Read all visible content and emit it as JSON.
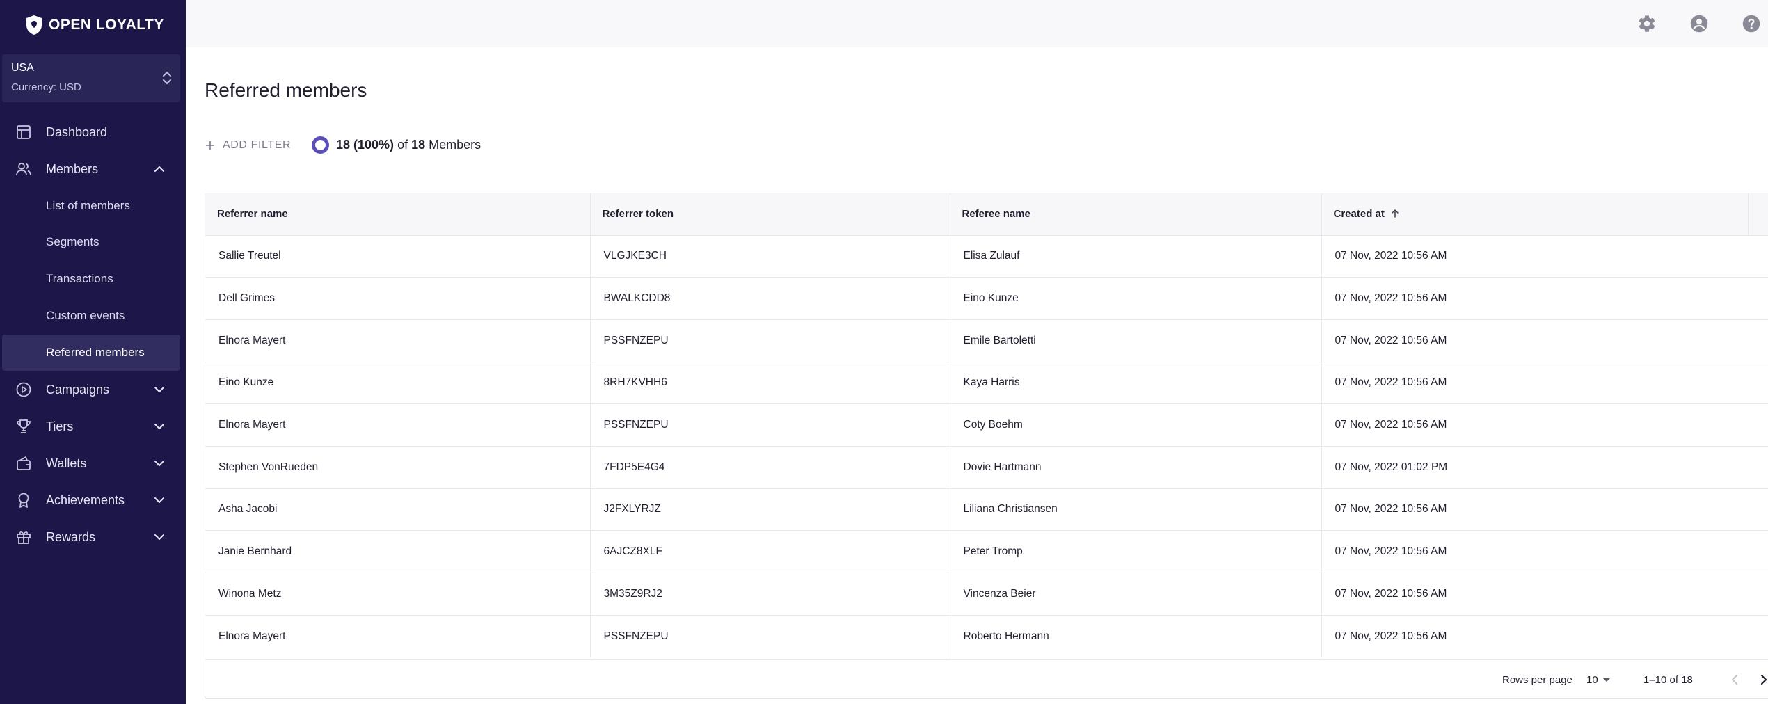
{
  "app": {
    "brand": "OPEN LOYALTY"
  },
  "store": {
    "name": "USA",
    "currency": "Currency: USD"
  },
  "sidebar": {
    "items": [
      {
        "label": "Dashboard",
        "icon": "dashboard-icon"
      },
      {
        "label": "Members",
        "icon": "members-icon",
        "expanded": true
      },
      {
        "label": "Campaigns",
        "icon": "campaigns-icon"
      },
      {
        "label": "Tiers",
        "icon": "trophy-icon"
      },
      {
        "label": "Wallets",
        "icon": "wallet-icon"
      },
      {
        "label": "Achievements",
        "icon": "badge-icon"
      },
      {
        "label": "Rewards",
        "icon": "gift-icon"
      }
    ],
    "members_sub": [
      {
        "label": "List of members"
      },
      {
        "label": "Segments"
      },
      {
        "label": "Transactions"
      },
      {
        "label": "Custom events"
      },
      {
        "label": "Referred members",
        "active": true
      }
    ]
  },
  "topbar": {
    "icons": [
      "settings-icon",
      "account-icon",
      "help-icon"
    ]
  },
  "page": {
    "title": "Referred members",
    "add_filter": "ADD FILTER",
    "count": "18 (100%)",
    "count_of": "of",
    "total": "18",
    "count_unit": "Members"
  },
  "table": {
    "columns": [
      "Referrer name",
      "Referrer token",
      "Referee name",
      "Created at"
    ],
    "sort_column": "Created at",
    "rows": [
      [
        "Sallie Treutel",
        "VLGJKE3CH",
        "Elisa Zulauf",
        "07 Nov, 2022 10:56 AM"
      ],
      [
        "Dell Grimes",
        "BWALKCDD8",
        "Eino Kunze",
        "07 Nov, 2022 10:56 AM"
      ],
      [
        "Elnora Mayert",
        "PSSFNZEPU",
        "Emile Bartoletti",
        "07 Nov, 2022 10:56 AM"
      ],
      [
        "Eino Kunze",
        "8RH7KVHH6",
        "Kaya Harris",
        "07 Nov, 2022 10:56 AM"
      ],
      [
        "Elnora Mayert",
        "PSSFNZEPU",
        "Coty Boehm",
        "07 Nov, 2022 10:56 AM"
      ],
      [
        "Stephen VonRueden",
        "7FDP5E4G4",
        "Dovie Hartmann",
        "07 Nov, 2022 01:02 PM"
      ],
      [
        "Asha Jacobi",
        "J2FXLYRJZ",
        "Liliana Christiansen",
        "07 Nov, 2022 10:56 AM"
      ],
      [
        "Janie Bernhard",
        "6AJCZ8XLF",
        "Peter Tromp",
        "07 Nov, 2022 10:56 AM"
      ],
      [
        "Winona Metz",
        "3M35Z9RJ2",
        "Vincenza Beier",
        "07 Nov, 2022 10:56 AM"
      ],
      [
        "Elnora Mayert",
        "PSSFNZEPU",
        "Roberto Hermann",
        "07 Nov, 2022 10:56 AM"
      ]
    ]
  },
  "pagination": {
    "rows_per_page_label": "Rows per page",
    "rows_per_page": "10",
    "range": "1–10 of 18"
  },
  "colors": {
    "sidebar_bg": "#1c1748",
    "accent": "#5a4fb8"
  }
}
